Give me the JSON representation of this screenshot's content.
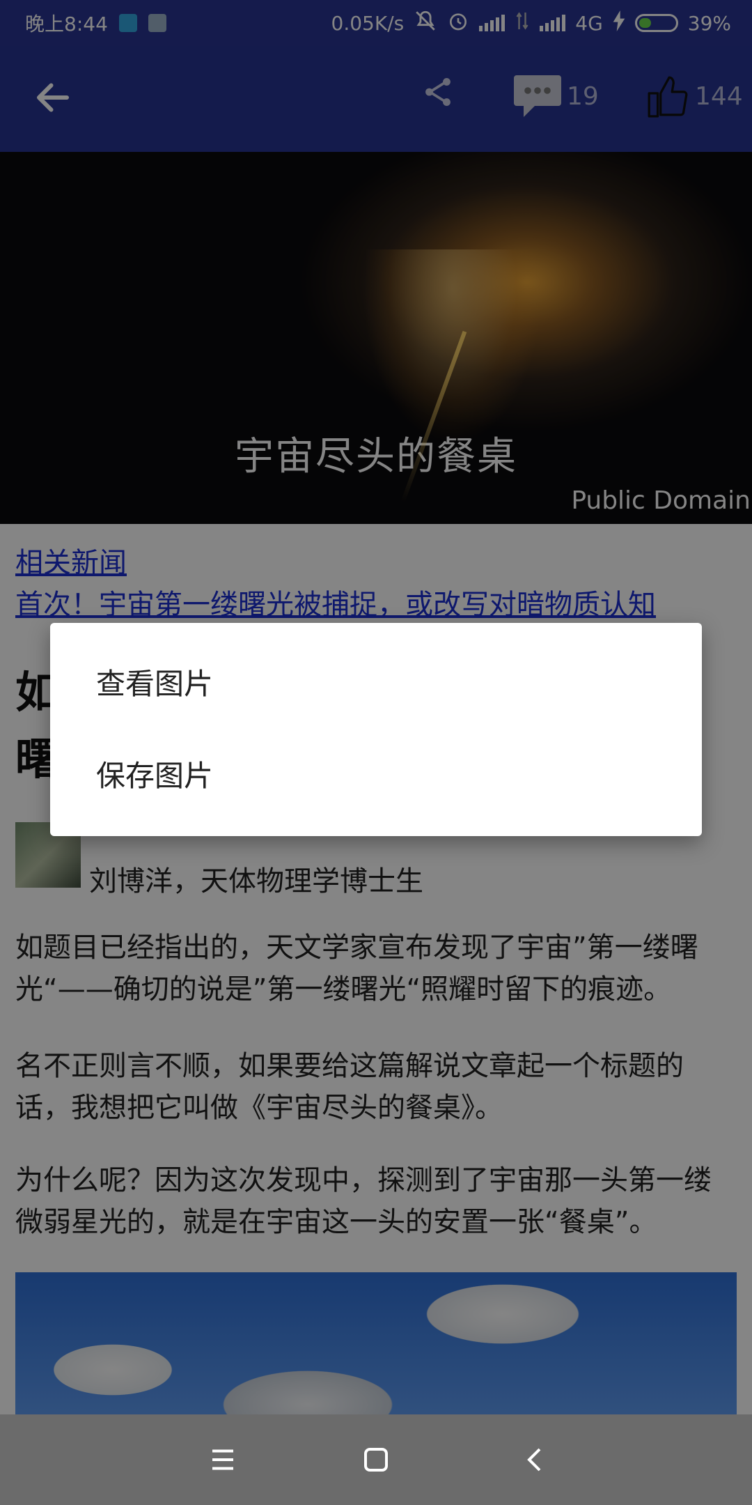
{
  "status_bar": {
    "time": "晚上8:44",
    "net_speed": "0.05K/s",
    "network_type": "4G",
    "battery": "39%"
  },
  "toolbar": {
    "comment_count": "19",
    "like_count": "144"
  },
  "hero": {
    "title": "宇宙尽头的餐桌",
    "credit": "Public Domain"
  },
  "article": {
    "related_label": "相关新闻",
    "related_link": "首次！宇宙第一缕曙光被捕捉，或改写对暗物质认知",
    "title_visible": "如\n曙",
    "author": "刘博洋，天体物理学博士生",
    "paragraphs": [
      "如题目已经指出的，天文学家宣布发现了宇宙”第一缕曙光“——确切的说是”第一缕曙光“照耀时留下的痕迹。",
      "名不正则言不顺，如果要给这篇解说文章起一个标题的话，我想把它叫做《宇宙尽头的餐桌》。",
      "为什么呢？因为这次发现中，探测到了宇宙那一头第一缕微弱星光的，就是在宇宙这一头的安置一张“餐桌”。"
    ]
  },
  "dialog": {
    "items": [
      "查看图片",
      "保存图片"
    ]
  },
  "colors": {
    "toolbar": "#283593",
    "link": "#1c2fd1",
    "nav_bar": "#6b6b6b"
  }
}
